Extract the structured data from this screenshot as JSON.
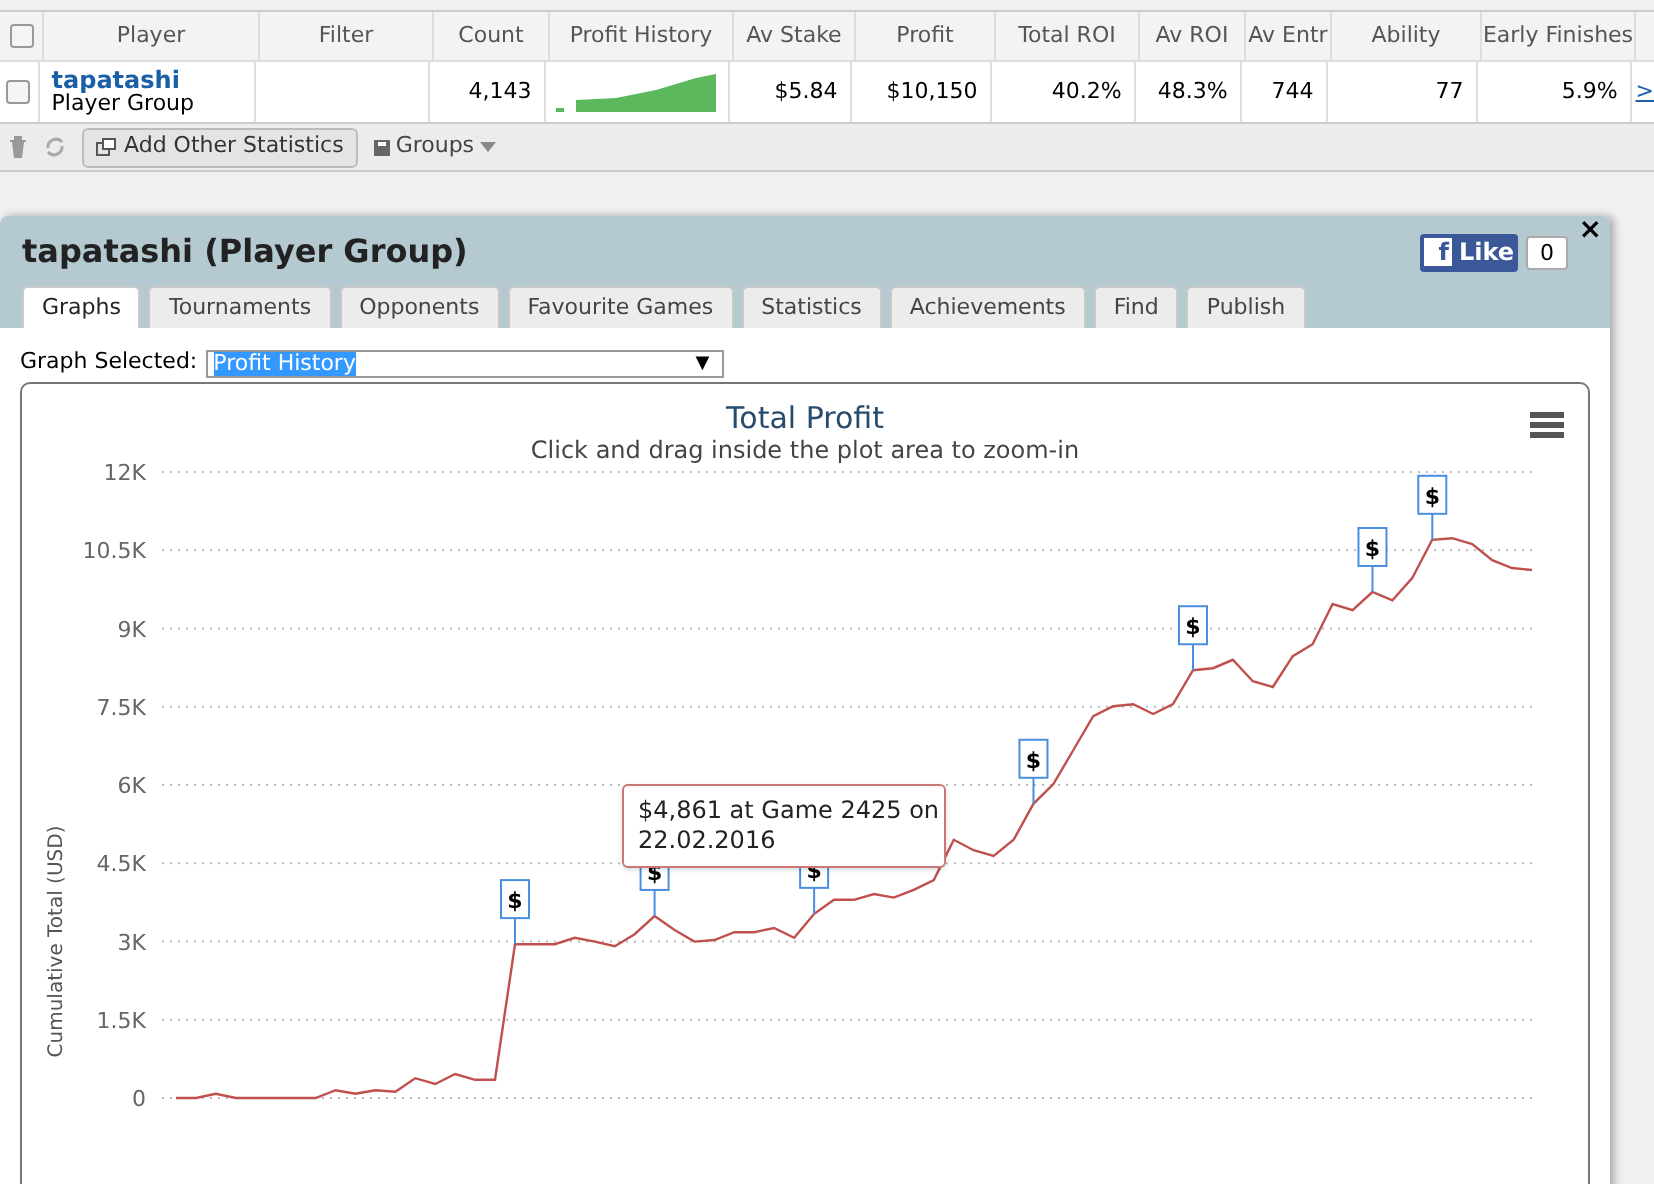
{
  "table": {
    "select_all_checked": false,
    "columns": [
      "Player",
      "Filter",
      "Count",
      "Profit History",
      "Av Stake",
      "Profit",
      "Total ROI",
      "Av ROI",
      "Av Entr",
      "Ability",
      "Early Finishes"
    ],
    "rows": [
      {
        "checked": false,
        "player": "tapatashi",
        "player_type": "Player Group",
        "filter": "",
        "count": "4,143",
        "av_stake": "$5.84",
        "profit": "$10,150",
        "total_roi": "40.2%",
        "av_roi": "48.3%",
        "av_entr": "744",
        "ability": "77",
        "early_finishes": "5.9%",
        "more": ">"
      }
    ]
  },
  "toolbar": {
    "add_button": "Add Other Statistics",
    "groups_button": "Groups"
  },
  "panel": {
    "title": "tapatashi (Player Group)",
    "close": "×",
    "like": {
      "glyph": "f",
      "label": "Like",
      "count": "0"
    },
    "tabs": [
      {
        "label": "Graphs",
        "selected": true
      },
      {
        "label": "Tournaments",
        "selected": false
      },
      {
        "label": "Opponents",
        "selected": false
      },
      {
        "label": "Favourite Games",
        "selected": false
      },
      {
        "label": "Statistics",
        "selected": false
      },
      {
        "label": "Achievements",
        "selected": false
      },
      {
        "label": "Find",
        "selected": false
      },
      {
        "label": "Publish",
        "selected": false
      }
    ],
    "graph_select": {
      "label": "Graph Selected:",
      "value": "Profit History",
      "arrow": "▼"
    },
    "chart": {
      "tooltip_lines": [
        "$4,861 at Game 2425 on",
        "22.02.2016"
      ],
      "chart_data": {
        "type": "line",
        "title": "Total Profit",
        "subtitle": "Click and drag inside the plot area to zoom-in",
        "ylabel": "Cumulative Total (USD)",
        "ylim": [
          0,
          12000
        ],
        "grid": true,
        "yticks": [
          {
            "value": 0,
            "label": "0"
          },
          {
            "value": 1500,
            "label": "1.5K"
          },
          {
            "value": 3000,
            "label": "3K"
          },
          {
            "value": 4500,
            "label": "4.5K"
          },
          {
            "value": 6000,
            "label": "6K"
          },
          {
            "value": 7500,
            "label": "7.5K"
          },
          {
            "value": 9000,
            "label": "9K"
          },
          {
            "value": 10500,
            "label": "10.5K"
          },
          {
            "value": 12000,
            "label": "12K"
          }
        ],
        "series": [
          {
            "color": "#c0504d",
            "values": [
              0,
              0,
              80,
              0,
              0,
              0,
              0,
              0,
              150,
              80,
              150,
              120,
              380,
              270,
              460,
              350,
              350,
              2950,
              2950,
              2950,
              3070,
              3000,
              2910,
              3140,
              3490,
              3220,
              3000,
              3030,
              3180,
              3180,
              3260,
              3070,
              3530,
              3800,
              3800,
              3910,
              3840,
              3990,
              4180,
              4950,
              4750,
              4640,
              4950,
              5640,
              6020,
              6670,
              7320,
              7510,
              7550,
              7360,
              7550,
              8200,
              8240,
              8400,
              7990,
              7880,
              8470,
              8700,
              9470,
              9350,
              9700,
              9540,
              9970,
              10700,
              10730,
              10620,
              10310,
              10160,
              10120
            ]
          }
        ],
        "annotations": [
          {
            "y": 2950,
            "text": "$"
          },
          {
            "y": 3490,
            "text": "$"
          },
          {
            "y": 3530,
            "text": "$"
          },
          {
            "y": 5640,
            "text": "$"
          },
          {
            "y": 8200,
            "text": "$"
          },
          {
            "y": 9700,
            "text": "$"
          },
          {
            "y": 10700,
            "text": "$"
          }
        ]
      }
    }
  }
}
